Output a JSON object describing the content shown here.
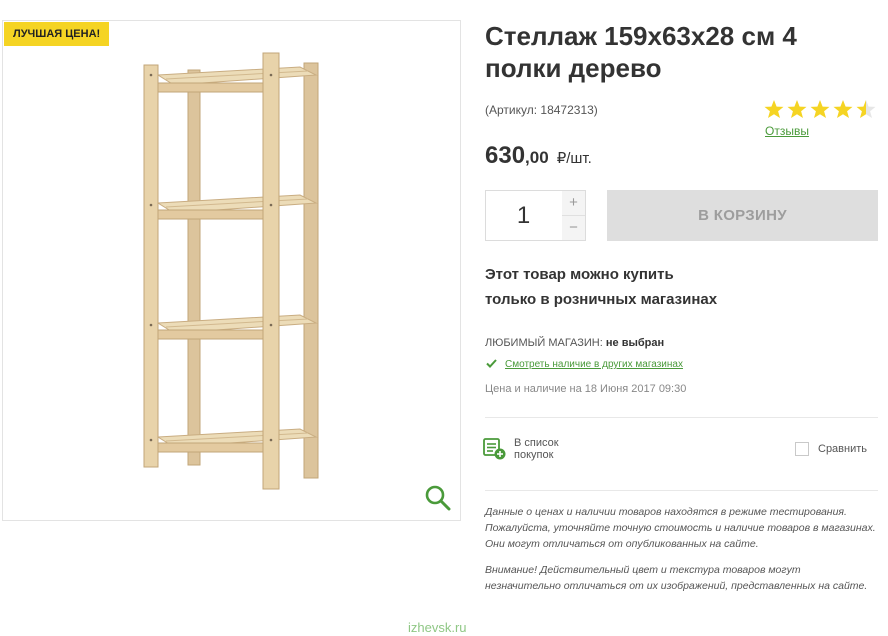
{
  "badge": "ЛУЧШАЯ ЦЕНА!",
  "product": {
    "title": "Стеллаж 159х63х28 см 4 полки дерево",
    "article": "(Артикул: 18472313)",
    "image_alt": "Стеллаж деревянный 4 полки"
  },
  "rating": {
    "value": 4.5,
    "max": 5,
    "reviews_label": "Отзывы",
    "star_color": "#f5d423"
  },
  "price": {
    "integer": "630",
    "fraction": ",00",
    "unit": "₽/шт."
  },
  "quantity": {
    "value": "1",
    "plus": "+",
    "minus": "−"
  },
  "cart_button": "В КОРЗИНУ",
  "retail_notice": {
    "line1": "Этот товар можно купить",
    "line2": "только в розничных магазинах"
  },
  "store": {
    "label": "ЛЮБИМЫЙ МАГАЗИН:",
    "value": "не выбран",
    "check_link": "Смотреть наличие в других магазинах",
    "updated": "Цена и наличие на 18 Июня 2017 09:30"
  },
  "actions": {
    "shopping_list_line1": "В список",
    "shopping_list_line2": "покупок",
    "compare": "Сравнить"
  },
  "notes": {
    "note1": "Данные о ценах и наличии товаров находятся в режиме тестирования. Пожалуйста, уточняйте точную стоимость и наличие товаров в магазинах. Они могут отличаться от опубликованных на сайте.",
    "note2": "Внимание! Действительный цвет и текстура товаров могут незначительно отличаться от их изображений, представленных на сайте."
  },
  "watermark": "izhevsk.ru",
  "colors": {
    "accent_green": "#4a9a3a",
    "badge_yellow": "#f5d423",
    "button_gray": "#dedede"
  },
  "icons": {
    "zoom": "magnifier-icon",
    "check": "checkmark-icon",
    "shopping_list": "list-add-icon",
    "star": "star-icon"
  }
}
